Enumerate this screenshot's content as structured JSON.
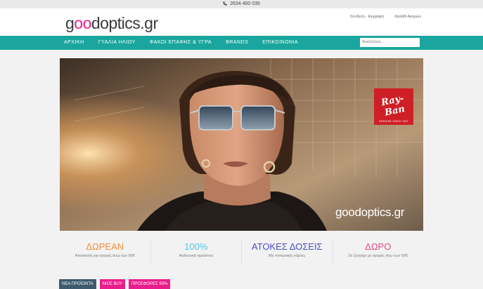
{
  "topbar": {
    "phone": "2634 400 035",
    "phone_icon": "phone-icon"
  },
  "header": {
    "logo_text_prefix": "g",
    "logo_o1": "o",
    "logo_o2": "o",
    "logo_text_suffix": "doptics.gr",
    "login_link": "Σύνδεση - Εγγραφή",
    "cart_link": "Καλάθι Αγορών"
  },
  "nav": {
    "items": [
      "ΑΡΧΙΚΗ",
      "ΓΥΑΛΙΑ ΗΛΙΟΥ",
      "ΦΑΚΟΙ ΕΠΑΦΗΣ & ΥΓΡΑ",
      "BRANDS",
      "ΕΠΙΚΟΙΝΩΝΙΑ"
    ],
    "search_placeholder": "Αναζήτηση..."
  },
  "hero": {
    "brand_badge": "Ray-Ban",
    "brand_badge_sub": "GENUINE SINCE 1937",
    "watermark": "goodoptics.gr"
  },
  "features": [
    {
      "title": "ΔΩΡΕΑΝ",
      "subtitle": "Αποστολή για αγορές άνω των 80€",
      "color": "#f0913a"
    },
    {
      "title": "100%",
      "subtitle": "Αυθεντικά προϊόντα",
      "color": "#4fc8e0"
    },
    {
      "title": "ΑΤΟΚΕΣ ΔΟΣΕΙΣ",
      "subtitle": "Με πιστωτικές κάρτες",
      "color": "#4a4fc4"
    },
    {
      "title": "ΔΩΡΟ",
      "subtitle": "2ο ζευγάρι με αγορές άνω των 50€",
      "color": "#e8488f"
    }
  ],
  "tabs": [
    {
      "label": "ΝΕΑ ΠΡΟΪΟΝΤΑ",
      "color": "#3d5a6e"
    },
    {
      "label": "NICE BUY",
      "color": "#e91e8c"
    },
    {
      "label": "ΠΡΟΣΦΟΡΕΣ 50%",
      "color": "#e91e8c"
    }
  ]
}
